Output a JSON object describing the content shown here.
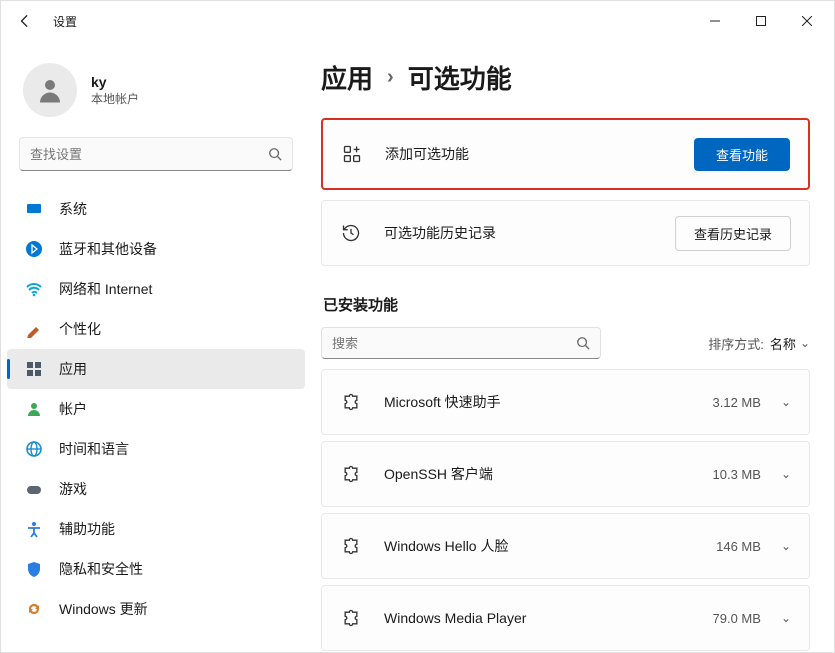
{
  "window": {
    "title": "设置"
  },
  "user": {
    "name": "ky",
    "sub": "本地帐户"
  },
  "search": {
    "placeholder": "查找设置"
  },
  "nav": [
    {
      "label": "系统",
      "icon": "system",
      "color": "#0078d4"
    },
    {
      "label": "蓝牙和其他设备",
      "icon": "bt",
      "color": "#0078d4"
    },
    {
      "label": "网络和 Internet",
      "icon": "wifi",
      "color": "#0aa5d9"
    },
    {
      "label": "个性化",
      "icon": "brush",
      "color": "#c05c2a"
    },
    {
      "label": "应用",
      "icon": "apps",
      "color": "#4b5a6a",
      "active": true
    },
    {
      "label": "帐户",
      "icon": "person",
      "color": "#3ba757"
    },
    {
      "label": "时间和语言",
      "icon": "globe",
      "color": "#1a8fd1"
    },
    {
      "label": "游戏",
      "icon": "game",
      "color": "#5b6670"
    },
    {
      "label": "辅助功能",
      "icon": "access",
      "color": "#2a7de1"
    },
    {
      "label": "隐私和安全性",
      "icon": "shield",
      "color": "#2a7de1"
    },
    {
      "label": "Windows 更新",
      "icon": "update",
      "color": "#d77a2a"
    }
  ],
  "breadcrumb": {
    "parent": "应用",
    "current": "可选功能"
  },
  "addCard": {
    "title": "添加可选功能",
    "button": "查看功能"
  },
  "historyCard": {
    "title": "可选功能历史记录",
    "button": "查看历史记录"
  },
  "installed": {
    "heading": "已安装功能",
    "search_placeholder": "搜索",
    "sort_label": "排序方式:",
    "sort_value": "名称",
    "items": [
      {
        "name": "Microsoft 快速助手",
        "size": "3.12 MB"
      },
      {
        "name": "OpenSSH 客户端",
        "size": "10.3 MB"
      },
      {
        "name": "Windows Hello 人脸",
        "size": "146 MB"
      },
      {
        "name": "Windows Media Player",
        "size": "79.0 MB"
      }
    ]
  }
}
